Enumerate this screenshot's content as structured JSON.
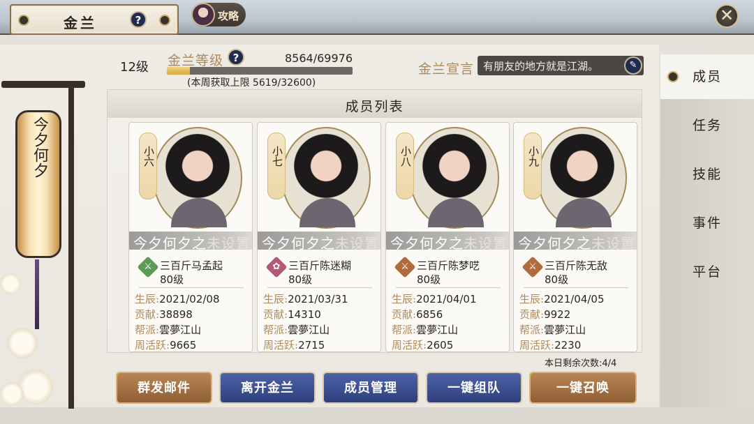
{
  "header": {
    "title": "金兰",
    "help_label": "?",
    "guide_label": "攻略",
    "close_label": "✕"
  },
  "lantern": {
    "text": "今夕何夕"
  },
  "info": {
    "level_text": "12级",
    "exp_label": "金兰等级",
    "exp_value": "8564/69976",
    "exp_fraction": 0.1224,
    "weekly_text": "(本周获取上限 5619/32600)",
    "motto_label": "金兰宣言",
    "motto_text": "有朋友的地方就是江湖。",
    "edit_icon": "pencil-icon"
  },
  "list": {
    "title": "成员列表",
    "labels": {
      "birthday": "生辰:",
      "contribution": "贡献:",
      "guild": "帮派:",
      "activity": "周活跃:"
    },
    "members": [
      {
        "nickname": "小六",
        "title_prefix": "今夕何夕之",
        "title_suffix": "未设置",
        "name": "三百斤马孟起",
        "level": "80级",
        "icon_glyph": "⚔",
        "icon_color": "#5c9a56",
        "birthday": "2021/02/08",
        "contribution": "38898",
        "guild": "雲夢江山",
        "activity": "9665"
      },
      {
        "nickname": "小七",
        "title_prefix": "今夕何夕之",
        "title_suffix": "未设置",
        "name": "三百斤陈迷糊",
        "level": "80级",
        "icon_glyph": "✿",
        "icon_color": "#b45a78",
        "birthday": "2021/03/31",
        "contribution": "14310",
        "guild": "雲夢江山",
        "activity": "2715"
      },
      {
        "nickname": "小八",
        "title_prefix": "今夕何夕之",
        "title_suffix": "未设置",
        "name": "三百斤陈梦呓",
        "level": "80级",
        "icon_glyph": "⚔",
        "icon_color": "#b06a3c",
        "birthday": "2021/04/01",
        "contribution": "6856",
        "guild": "雲夢江山",
        "activity": "2605"
      },
      {
        "nickname": "小九",
        "title_prefix": "今夕何夕之",
        "title_suffix": "未设置",
        "name": "三百斤陈无敌",
        "level": "80级",
        "icon_glyph": "⚔",
        "icon_color": "#b06a3c",
        "birthday": "2021/04/05",
        "contribution": "9922",
        "guild": "雲夢江山",
        "activity": "2230"
      }
    ],
    "remaining_text": "本日剩余次数:4/4"
  },
  "actions": {
    "mass_mail": "群发邮件",
    "leave": "离开金兰",
    "manage": "成员管理",
    "one_click_team": "一键组队",
    "one_click_summon": "一键召唤"
  },
  "nav": {
    "items": [
      "成员",
      "任务",
      "技能",
      "事件",
      "平台"
    ],
    "active_index": 0
  }
}
